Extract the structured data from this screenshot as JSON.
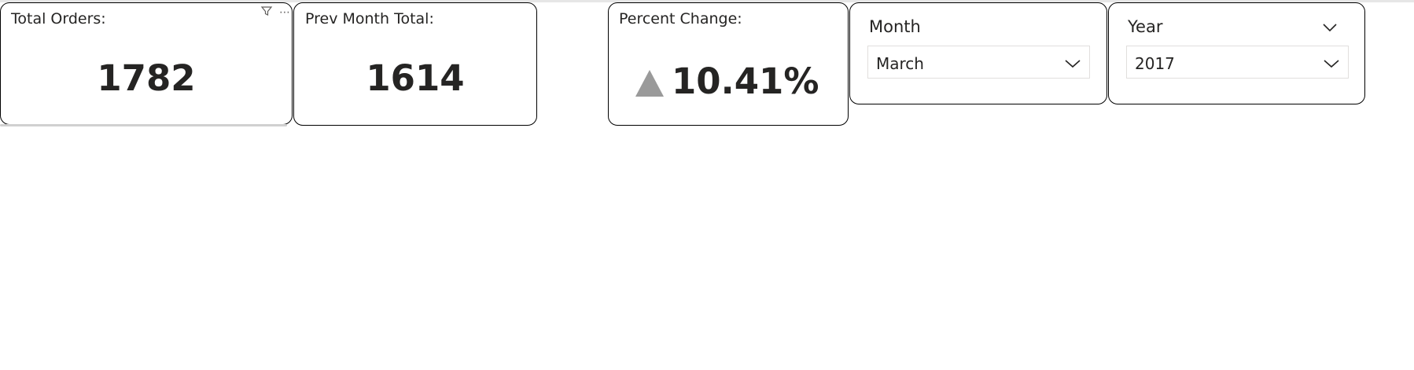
{
  "cards": {
    "total_orders": {
      "title": "Total Orders:",
      "value": "1782"
    },
    "prev_month_total": {
      "title": "Prev Month Total:",
      "value": "1614"
    },
    "percent_change": {
      "title": "Percent Change:",
      "value": "10.41%",
      "indicator": "up-triangle-icon",
      "indicator_color": "#9a9a9a"
    }
  },
  "visual_header": {
    "filter_icon": "filter-icon",
    "more_options": "⋯"
  },
  "slicers": {
    "month": {
      "header": "Month",
      "selected": "March"
    },
    "year": {
      "header": "Year",
      "selected": "2017"
    }
  },
  "colors": {
    "text": "#252423",
    "border": "#000000",
    "indicator": "#9a9a9a",
    "dropdown_border": "#e1dfdd"
  }
}
